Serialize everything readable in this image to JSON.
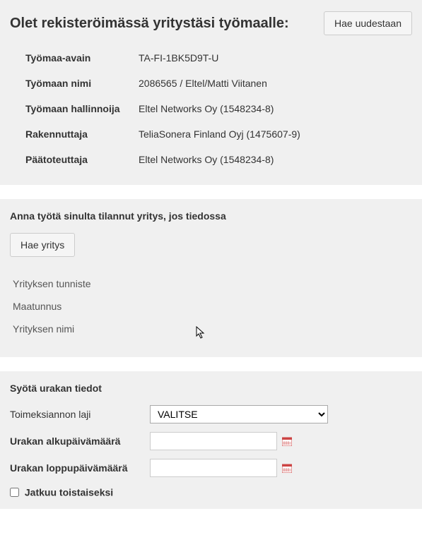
{
  "header": {
    "title": "Olet rekisteröimässä yritystäsi työmaalle:",
    "search_again_button": "Hae uudestaan"
  },
  "worksite": {
    "key_label": "Työmaa-avain",
    "key_value": "TA-FI-1BK5D9T-U",
    "name_label": "Työmaan nimi",
    "name_value": "2086565 / Eltel/Matti Viitanen",
    "admin_label": "Työmaan hallinnoija",
    "admin_value": "Eltel Networks Oy (1548234-8)",
    "developer_label": "Rakennuttaja",
    "developer_value": "TeliaSonera Finland Oyj (1475607-9)",
    "main_contractor_label": "Päätoteuttaja",
    "main_contractor_value": "Eltel Networks Oy (1548234-8)"
  },
  "company_section": {
    "title": "Anna työtä sinulta tilannut yritys, jos tiedossa",
    "search_button": "Hae yritys",
    "id_label": "Yrityksen tunniste",
    "country_label": "Maatunnus",
    "name_label": "Yrityksen nimi"
  },
  "contract_section": {
    "title": "Syötä urakan tiedot",
    "type_label": "Toimeksiannon laji",
    "type_select_value": "VALITSE",
    "start_date_label": "Urakan alkupäivämäärä",
    "end_date_label": "Urakan loppupäivämäärä",
    "ongoing_label": "Jatkuu toistaiseksi"
  }
}
